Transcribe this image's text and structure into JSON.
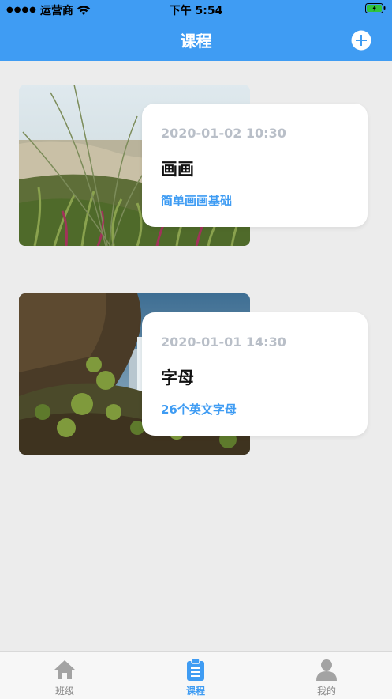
{
  "status_bar": {
    "carrier": "运营商",
    "time": "下午 5:54"
  },
  "header": {
    "title": "课程",
    "add_icon": "plus-circle-icon"
  },
  "courses": [
    {
      "datetime": "2020-01-02 10:30",
      "title": "画画",
      "description": "简单画画基础",
      "image": "beach-grass-photo"
    },
    {
      "datetime": "2020-01-01 14:30",
      "title": "字母",
      "description": "26个英文字母",
      "image": "waterfall-cliff-photo"
    }
  ],
  "tabbar": {
    "items": [
      {
        "label": "班级",
        "icon": "home-icon",
        "active": false
      },
      {
        "label": "课程",
        "icon": "clipboard-icon",
        "active": true
      },
      {
        "label": "我的",
        "icon": "user-icon",
        "active": false
      }
    ]
  },
  "colors": {
    "accent": "#3f9cf3",
    "background": "#ececec",
    "date_text": "#b9bfc8"
  }
}
